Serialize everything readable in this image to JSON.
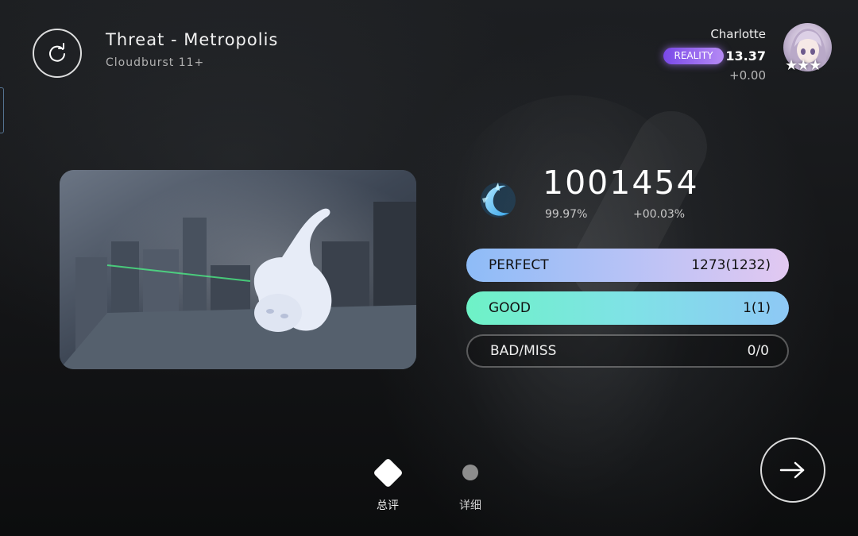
{
  "song": {
    "title": "Threat - Metropolis",
    "difficulty": "Cloudburst 11+"
  },
  "player": {
    "name": "Charlotte",
    "tier": "REALITY",
    "rks": "13.37",
    "rks_change": "+0.00",
    "stars": "★★★"
  },
  "result": {
    "score": "1001454",
    "accuracy": "99.97%",
    "accuracy_change": "+00.03%"
  },
  "judgements": [
    {
      "label": "PERFECT",
      "value": "1273(1232)"
    },
    {
      "label": "GOOD",
      "value": "1(1)"
    },
    {
      "label": "BAD/MISS",
      "value": "0/0"
    }
  ],
  "nav": {
    "overview_label": "总评",
    "detail_label": "详细",
    "active": "overview"
  },
  "icons": {
    "retry": "retry-icon",
    "next": "arrow-right-icon",
    "grade": "grade-moon-icon"
  },
  "colors": {
    "perfect_start": "#8ebcf7",
    "perfect_end": "#e2c8f1",
    "good_start": "#6ef2c6",
    "good_end": "#8ec8f5",
    "tier_badge": "#9b6cf0"
  }
}
